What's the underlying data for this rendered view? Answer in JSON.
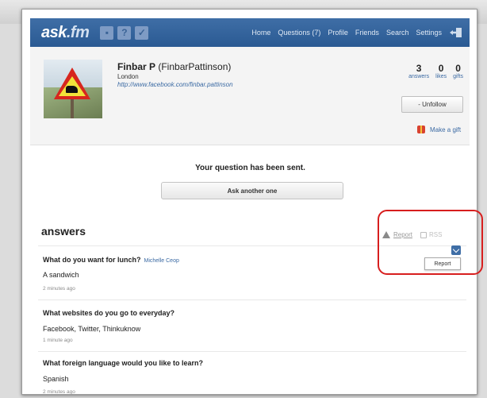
{
  "nav": {
    "logo_text": "ask",
    "logo_suffix": ".fm",
    "icons": [
      "chat-icon",
      "question-icon",
      "check-icon"
    ],
    "links": [
      "Home",
      "Questions (7)",
      "Profile",
      "Friends",
      "Search",
      "Settings"
    ],
    "color": "#3a6aa1"
  },
  "profile": {
    "display_name": "Finbar P",
    "username": "(FinbarPattinson)",
    "location": "London",
    "link": "http://www.facebook.com/finbar.pattinson",
    "stats": [
      {
        "count": "3",
        "label": "answers"
      },
      {
        "count": "0",
        "label": "likes"
      },
      {
        "count": "0",
        "label": "gifts"
      }
    ],
    "unfollow_label": "- Unfollow",
    "gift_label": "Make a gift"
  },
  "sent": {
    "message": "Your question has been sent.",
    "ask_another_label": "Ask another one"
  },
  "answers": {
    "title": "answers",
    "report_label": "Report",
    "rss_label": "RSS",
    "menu_report_label": "Report",
    "items": [
      {
        "question": "What do you want for lunch?",
        "asker": "Michelle Ceop",
        "answer": "A sandwich",
        "time": "2 minutes ago"
      },
      {
        "question": "What websites do you go to everyday?",
        "asker": "",
        "answer": "Facebook, Twitter, Thinkuknow",
        "time": "1 minute ago"
      },
      {
        "question": "What foreign language would you like to learn?",
        "asker": "",
        "answer": "Spanish",
        "time": "2 minutes ago"
      }
    ]
  },
  "colors": {
    "highlight": "#d71e1e",
    "link": "#3b6aa3"
  }
}
